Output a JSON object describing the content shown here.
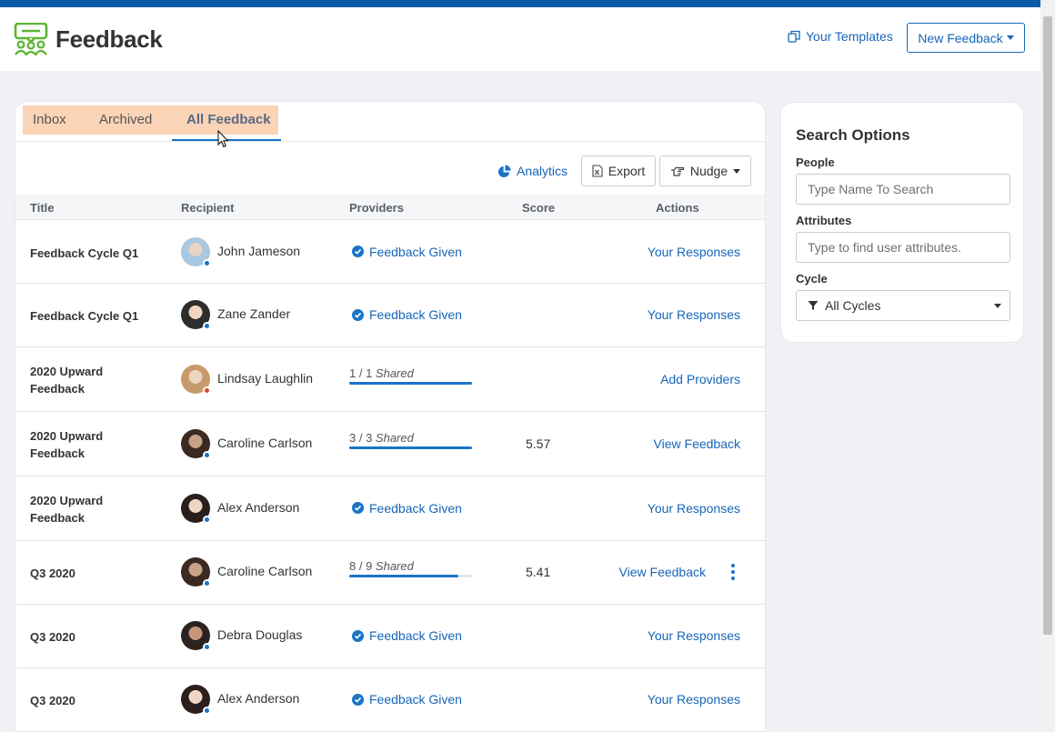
{
  "app": {
    "title": "Feedback",
    "your_templates": "Your Templates",
    "new_feedback": "New Feedback"
  },
  "tabs": [
    {
      "label": "Inbox",
      "active": false
    },
    {
      "label": "Archived",
      "active": false
    },
    {
      "label": "All Feedback",
      "active": true
    }
  ],
  "toolbar": {
    "analytics": "Analytics",
    "export": "Export",
    "nudge": "Nudge"
  },
  "table": {
    "columns": [
      "Title",
      "Recipient",
      "Providers",
      "Score",
      "Actions"
    ],
    "rows": [
      {
        "title": "Feedback Cycle Q1",
        "recipient": "John Jameson",
        "status_dot": "blue",
        "providers_type": "given",
        "providers_text": "Feedback Given",
        "score": "",
        "action": "Your Responses"
      },
      {
        "title": "Feedback Cycle Q1",
        "recipient": "Zane Zander",
        "status_dot": "blue",
        "providers_type": "given",
        "providers_text": "Feedback Given",
        "score": "",
        "action": "Your Responses"
      },
      {
        "title": "2020 Upward Feedback",
        "recipient": "Lindsay Laughlin",
        "status_dot": "red",
        "providers_type": "shared",
        "shared_count": "1 / 1",
        "shared_word": "Shared",
        "progress": 1.0,
        "score": "",
        "action": "Add Providers"
      },
      {
        "title": "2020 Upward Feedback",
        "recipient": "Caroline Carlson",
        "status_dot": "blue",
        "providers_type": "shared",
        "shared_count": "3 / 3",
        "shared_word": "Shared",
        "progress": 1.0,
        "score": "5.57",
        "action": "View Feedback"
      },
      {
        "title": "2020 Upward Feedback",
        "recipient": "Alex Anderson",
        "status_dot": "blue",
        "providers_type": "given",
        "providers_text": "Feedback Given",
        "score": "",
        "action": "Your Responses"
      },
      {
        "title": "Q3 2020",
        "recipient": "Caroline Carlson",
        "status_dot": "blue",
        "providers_type": "shared",
        "shared_count": "8 / 9",
        "shared_word": "Shared",
        "progress": 0.89,
        "score": "5.41",
        "action": "View Feedback",
        "has_menu": true
      },
      {
        "title": "Q3 2020",
        "recipient": "Debra Douglas",
        "status_dot": "blue",
        "providers_type": "given",
        "providers_text": "Feedback Given",
        "score": "",
        "action": "Your Responses"
      },
      {
        "title": "Q3 2020",
        "recipient": "Alex Anderson",
        "status_dot": "blue",
        "providers_type": "given",
        "providers_text": "Feedback Given",
        "score": "",
        "action": "Your Responses"
      }
    ]
  },
  "search": {
    "title": "Search Options",
    "people_label": "People",
    "people_placeholder": "Type Name To Search",
    "attributes_label": "Attributes",
    "attributes_placeholder": "Type to find user attributes.",
    "cycle_label": "Cycle",
    "cycle_value": "All Cycles"
  },
  "colors": {
    "brand_blue": "#1666b8",
    "accent_blue": "#1a74c7",
    "top_stripe": "#0a5aa8",
    "tab_highlight": "#fbd3b6",
    "logo_green": "#5cb531",
    "status_blue": "#1a74c7",
    "status_red": "#d9432f"
  },
  "icons": {
    "logo": "team-feedback-icon",
    "templates": "copy-icon",
    "analytics": "pie-chart-icon",
    "export": "excel-file-icon",
    "nudge": "pointing-hand-icon",
    "check": "check-circle-icon",
    "filter": "filter-icon",
    "menu": "kebab-menu-icon"
  }
}
